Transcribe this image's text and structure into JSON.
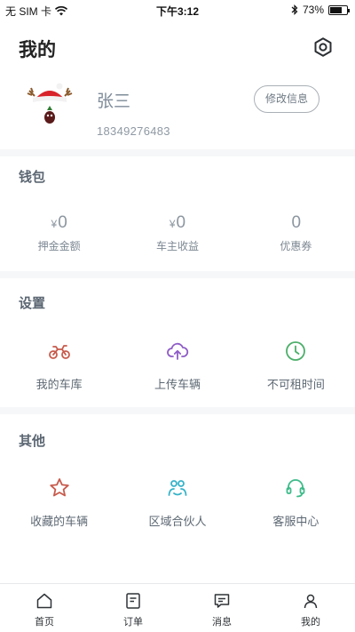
{
  "status_bar": {
    "carrier": "无 SIM 卡",
    "time": "下午3:12",
    "battery_percent": "73%",
    "battery_level": 0.73
  },
  "header": {
    "title": "我的"
  },
  "profile": {
    "name": "张三",
    "phone": "18349276483",
    "edit_label": "修改信息"
  },
  "wallet": {
    "title": "钱包",
    "items": [
      {
        "currency": "¥",
        "value": "0",
        "label": "押金金额"
      },
      {
        "currency": "¥",
        "value": "0",
        "label": "车主收益"
      },
      {
        "currency": "",
        "value": "0",
        "label": "优惠券"
      }
    ]
  },
  "settings": {
    "title": "设置",
    "items": [
      {
        "label": "我的车库",
        "icon": "motorcycle-icon",
        "color": "#c85a4c"
      },
      {
        "label": "上传车辆",
        "icon": "cloud-upload-icon",
        "color": "#8e5cc7"
      },
      {
        "label": "不可租时间",
        "icon": "clock-icon",
        "color": "#4caf6a"
      }
    ]
  },
  "other": {
    "title": "其他",
    "items": [
      {
        "label": "收藏的车辆",
        "icon": "star-icon",
        "color": "#c85a4c"
      },
      {
        "label": "区域合伙人",
        "icon": "partners-icon",
        "color": "#36b3c9"
      },
      {
        "label": "客服中心",
        "icon": "headset-icon",
        "color": "#3dbb8a"
      }
    ]
  },
  "tabbar": {
    "items": [
      {
        "label": "首页",
        "icon": "home-icon"
      },
      {
        "label": "订单",
        "icon": "order-icon"
      },
      {
        "label": "消息",
        "icon": "message-icon"
      },
      {
        "label": "我的",
        "icon": "profile-icon"
      }
    ]
  }
}
